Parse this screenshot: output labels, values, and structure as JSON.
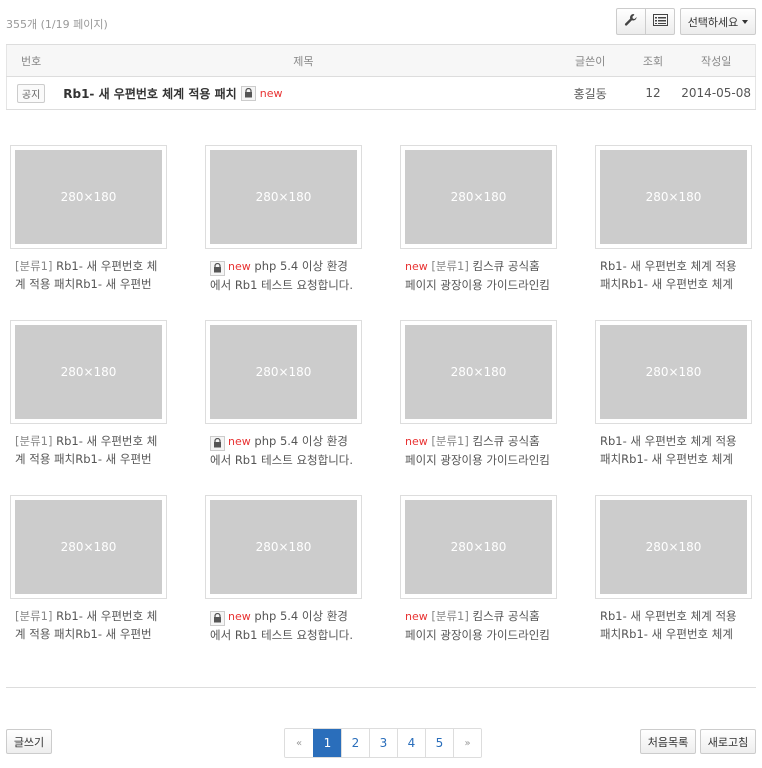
{
  "header": {
    "total_text": "355개 (1/19 페이지)",
    "select_label": "선택하세요",
    "tool_icons": [
      "wrench-icon",
      "list-view-icon"
    ]
  },
  "table": {
    "columns": [
      "번호",
      "제목",
      "글쓴이",
      "조회",
      "작성일"
    ],
    "notice": {
      "badge": "공지",
      "title": "Rb1- 새 우편번호 체계 적용 패치",
      "new_label": "new",
      "author": "홍길동",
      "views": "12",
      "date": "2014-05-08"
    }
  },
  "gallery": {
    "placeholder": "280×180",
    "new_label": "new",
    "rows": [
      [
        {
          "category": "[분류1]",
          "text": "Rb1- 새 우편번호 체계 적용 패치Rb1- 새 우편번"
        },
        {
          "locked": true,
          "is_new": true,
          "text": "php 5.4 이상 환경에서 Rb1 테스트 요청합니다."
        },
        {
          "is_new": true,
          "category": "[분류1]",
          "text": "킴스큐 공식홈페이지 광장이용 가이드라인킴"
        },
        {
          "text": "Rb1- 새 우편번호 체계 적용 패치Rb1- 새 우편번호 체계"
        }
      ],
      [
        {
          "category": "[분류1]",
          "text": "Rb1- 새 우편번호 체계 적용 패치Rb1- 새 우편번"
        },
        {
          "locked": true,
          "is_new": true,
          "text": "php 5.4 이상 환경에서 Rb1 테스트 요청합니다."
        },
        {
          "is_new": true,
          "category": "[분류1]",
          "text": "킴스큐 공식홈페이지 광장이용 가이드라인킴"
        },
        {
          "text": "Rb1- 새 우편번호 체계 적용 패치Rb1- 새 우편번호 체계"
        }
      ],
      [
        {
          "category": "[분류1]",
          "text": "Rb1- 새 우편번호 체계 적용 패치Rb1- 새 우편번"
        },
        {
          "locked": true,
          "is_new": true,
          "text": "php 5.4 이상 환경에서 Rb1 테스트 요청합니다."
        },
        {
          "is_new": true,
          "category": "[분류1]",
          "text": "킴스큐 공식홈페이지 광장이용 가이드라인킴"
        },
        {
          "text": "Rb1- 새 우편번호 체계 적용 패치Rb1- 새 우편번호 체계"
        }
      ]
    ]
  },
  "footer": {
    "write_label": "글쓰기",
    "list_label": "처음목록",
    "refresh_label": "새로고침",
    "pagination": {
      "prev": "«",
      "pages": [
        "1",
        "2",
        "3",
        "4",
        "5"
      ],
      "current": "1",
      "next": "»"
    }
  }
}
